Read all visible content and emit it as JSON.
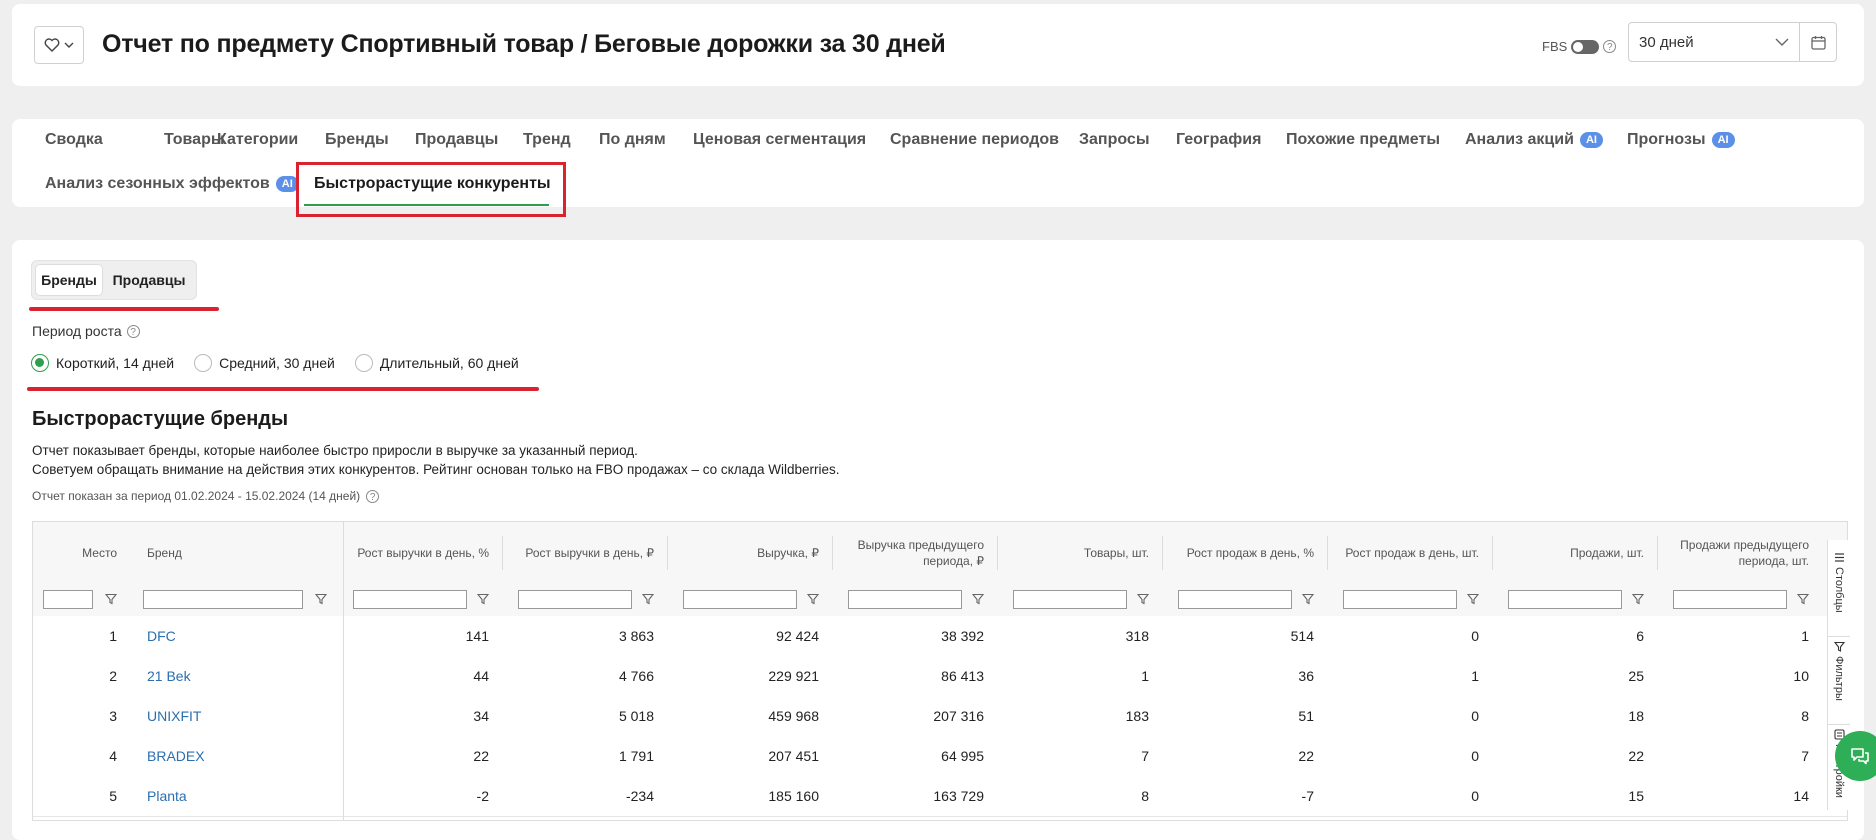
{
  "header": {
    "title": "Отчет по предмету Спортивный товар / Беговые дорожки за 30 дней",
    "fbs_label": "FBS",
    "period_value": "30 дней"
  },
  "tabs": [
    {
      "label": "Сводка"
    },
    {
      "label": "Товары"
    },
    {
      "label": "Категории"
    },
    {
      "label": "Бренды"
    },
    {
      "label": "Продавцы"
    },
    {
      "label": "Тренд"
    },
    {
      "label": "По дням"
    },
    {
      "label": "Ценовая сегментация"
    },
    {
      "label": "Сравнение периодов"
    },
    {
      "label": "Запросы"
    },
    {
      "label": "География"
    },
    {
      "label": "Похожие предметы"
    },
    {
      "label": "Анализ акций",
      "badge": "AI"
    },
    {
      "label": "Прогнозы",
      "badge": "AI"
    },
    {
      "label": "Анализ сезонных эффектов",
      "badge": "AI"
    },
    {
      "label": "Быстрорастущие конкуренты",
      "active": true
    }
  ],
  "segment": {
    "brands": "Бренды",
    "sellers": "Продавцы"
  },
  "growth_period": {
    "label": "Период роста",
    "options": [
      "Короткий, 14 дней",
      "Средний, 30 дней",
      "Длительный, 60 дней"
    ],
    "selected": "Короткий, 14 дней"
  },
  "section": {
    "title": "Быстрорастущие бренды",
    "desc1": "Отчет показывает бренды, которые наиболее быстро приросли в выручке за указанный период.",
    "desc2": "Советуем обращать внимание на действия этих конкурентов. Рейтинг основан только на FBO продажах – со склада Wildberries.",
    "period_info": "Отчет показан за период 01.02.2024 - 15.02.2024 (14 дней)"
  },
  "table": {
    "columns": [
      "Место",
      "Бренд",
      "Рост выручки в день, %",
      "Рост выручки в день, ₽",
      "Выручка, ₽",
      "Выручка предыдущего периода, ₽",
      "Товары, шт.",
      "Рост продаж в день, %",
      "Рост продаж в день, шт.",
      "Продажи, шт.",
      "Продажи предыдущего периода, шт."
    ],
    "rows": [
      [
        "1",
        "DFC",
        "141",
        "3 863",
        "92 424",
        "38 392",
        "318",
        "514",
        "0",
        "6",
        "1"
      ],
      [
        "2",
        "21 Bek",
        "44",
        "4 766",
        "229 921",
        "86 413",
        "1",
        "36",
        "1",
        "25",
        "10"
      ],
      [
        "3",
        "UNIXFIT",
        "34",
        "5 018",
        "459 968",
        "207 316",
        "183",
        "51",
        "0",
        "18",
        "8"
      ],
      [
        "4",
        "BRADEX",
        "22",
        "1 791",
        "207 451",
        "64 995",
        "7",
        "22",
        "0",
        "22",
        "7"
      ],
      [
        "5",
        "Planta",
        "-2",
        "-234",
        "185 160",
        "163 729",
        "8",
        "-7",
        "0",
        "15",
        "14"
      ]
    ]
  },
  "side_panel": {
    "columns": "Столбцы",
    "filters": "Фильтры",
    "settings": "Настройки"
  },
  "colors": {
    "accent_green": "#2e9e4f",
    "highlight_red": "#d9232e",
    "ai_badge": "#5b8fe8",
    "link": "#2a6fb0"
  }
}
